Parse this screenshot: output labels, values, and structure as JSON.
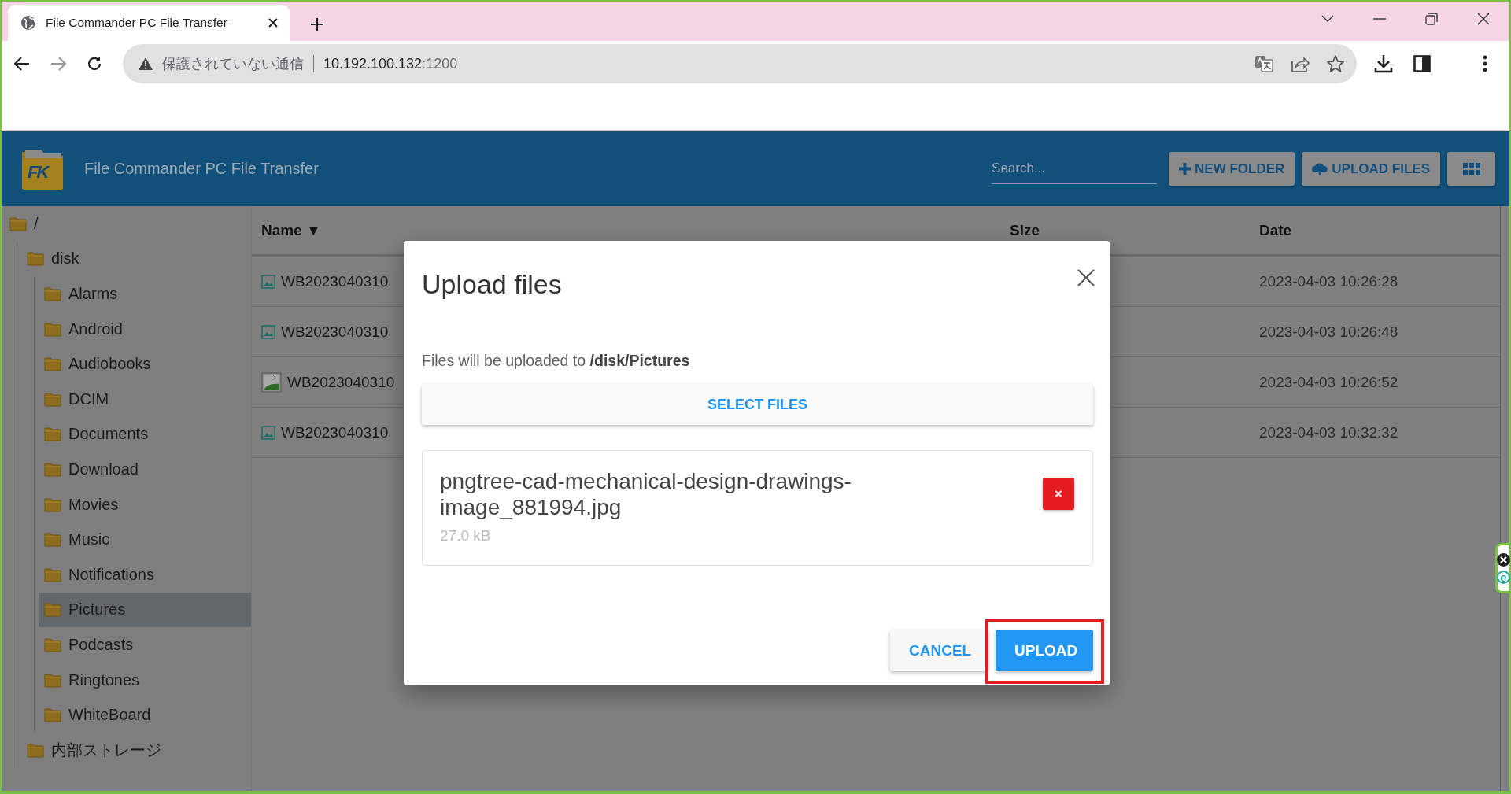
{
  "browser": {
    "tab": {
      "title": "File Commander PC File Transfer",
      "selected": true
    },
    "security": "保護されていない通信",
    "address": {
      "host": "10.192.100.132",
      "port": ":1200"
    }
  },
  "header": {
    "logo": "FK",
    "title": "File Commander PC File Transfer",
    "search": {
      "placeholder": "Search..."
    },
    "buttons": [
      {
        "kind": "new-folder",
        "label": "NEW FOLDER"
      },
      {
        "kind": "upload",
        "label": "UPLOAD FILES"
      },
      {
        "kind": "grid"
      }
    ]
  },
  "sidebar": {
    "items": [
      {
        "name": "/",
        "selected": false,
        "children": [
          {
            "name": "disk",
            "selected": false,
            "children": [
              {
                "name": "Alarms",
                "selected": false
              },
              {
                "name": "Android",
                "selected": false
              },
              {
                "name": "Audiobooks",
                "selected": false
              },
              {
                "name": "DCIM",
                "selected": false
              },
              {
                "name": "Documents",
                "selected": false
              },
              {
                "name": "Download",
                "selected": false
              },
              {
                "name": "Movies",
                "selected": false
              },
              {
                "name": "Music",
                "selected": false
              },
              {
                "name": "Notifications",
                "selected": false
              },
              {
                "name": "Pictures",
                "selected": true
              },
              {
                "name": "Podcasts",
                "selected": false
              },
              {
                "name": "Ringtones",
                "selected": false
              },
              {
                "name": "WhiteBoard",
                "selected": false
              }
            ]
          },
          {
            "name": "内部ストレージ",
            "selected": false
          }
        ]
      }
    ]
  },
  "table": {
    "columns": [
      {
        "label": "Name",
        "sort": "▼"
      },
      {
        "label": "Size"
      },
      {
        "label": "Date"
      }
    ],
    "rows": [
      {
        "kind": "image",
        "name": "WB2023040310",
        "date": "2023-04-03 10:26:28"
      },
      {
        "kind": "image",
        "name": "WB2023040310",
        "date": "2023-04-03 10:26:48"
      },
      {
        "kind": "thumbnail",
        "name": "WB2023040310",
        "date": "2023-04-03 10:26:52"
      },
      {
        "kind": "image",
        "name": "WB2023040310",
        "date": "2023-04-03 10:32:32"
      }
    ]
  },
  "dialog": {
    "title": "Upload files",
    "destination": "Files will be uploaded to **/disk/Pictures**",
    "select_button": "SELECT FILES",
    "files": [
      {
        "name": "pngtree-cad-mechanical-design-drawings-image_881994.jpg",
        "size": "27.0 kB",
        "remove": "×"
      }
    ],
    "actions": [
      {
        "kind": "cancel",
        "label": "CANCEL",
        "highlighted": false
      },
      {
        "kind": "upload",
        "label": "UPLOAD",
        "highlighted": true
      }
    ]
  },
  "side_widget": {
    "logo": "e"
  }
}
